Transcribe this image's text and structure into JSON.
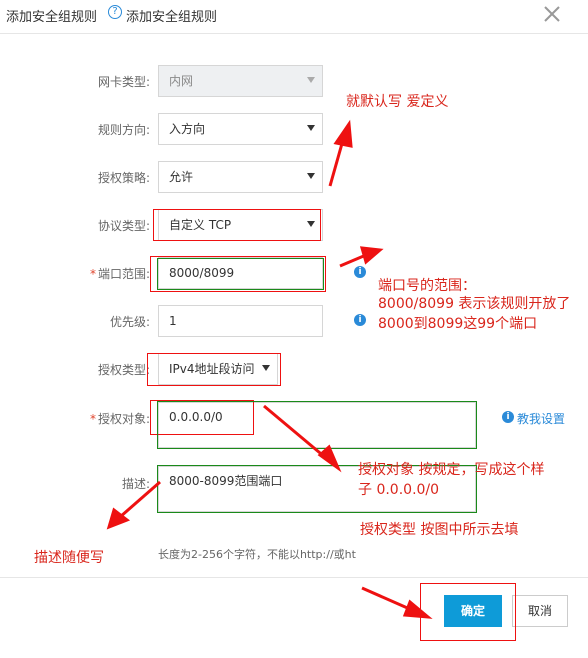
{
  "header": {
    "title": "添加安全组规则",
    "help_glyph": "?",
    "subtitle": "添加安全组规则"
  },
  "form": {
    "nic_type": {
      "label": "网卡类型:",
      "value": "内网"
    },
    "direction": {
      "label": "规则方向:",
      "value": "入方向"
    },
    "policy": {
      "label": "授权策略:",
      "value": "允许"
    },
    "protocol": {
      "label": "协议类型:",
      "value": "自定义 TCP"
    },
    "port_range": {
      "label": "端口范围:",
      "value": "8000/8099"
    },
    "priority": {
      "label": "优先级:",
      "value": "1"
    },
    "auth_type": {
      "label": "授权类型:",
      "value": "IPv4地址段访问"
    },
    "auth_object": {
      "label": "授权对象:",
      "value": "0.0.0.0/0",
      "help_link": "教我设置"
    },
    "description": {
      "label": "描述:",
      "value": "8000-8099范围端口",
      "hint": "长度为2-256个字符，不能以http://或ht"
    },
    "required_mark": "*",
    "info_glyph": "i"
  },
  "buttons": {
    "ok": "确定",
    "cancel": "取消"
  },
  "annotations": {
    "default": "就默认写  爱定义",
    "port_lines": [
      "端口号的范围：",
      "8000/8099  表示该规则开放了",
      "8000到8099这99个端口"
    ],
    "object_lines": [
      "授权对象  按规定，写成这个样",
      "子  0.0.0.0/0"
    ],
    "auth_type_note": "授权类型  按图中所示去填",
    "desc_note": "描述随便写"
  },
  "colors": {
    "accent": "#0e9bd8",
    "annotation": "#d9261c",
    "link": "#2a8ad8"
  }
}
